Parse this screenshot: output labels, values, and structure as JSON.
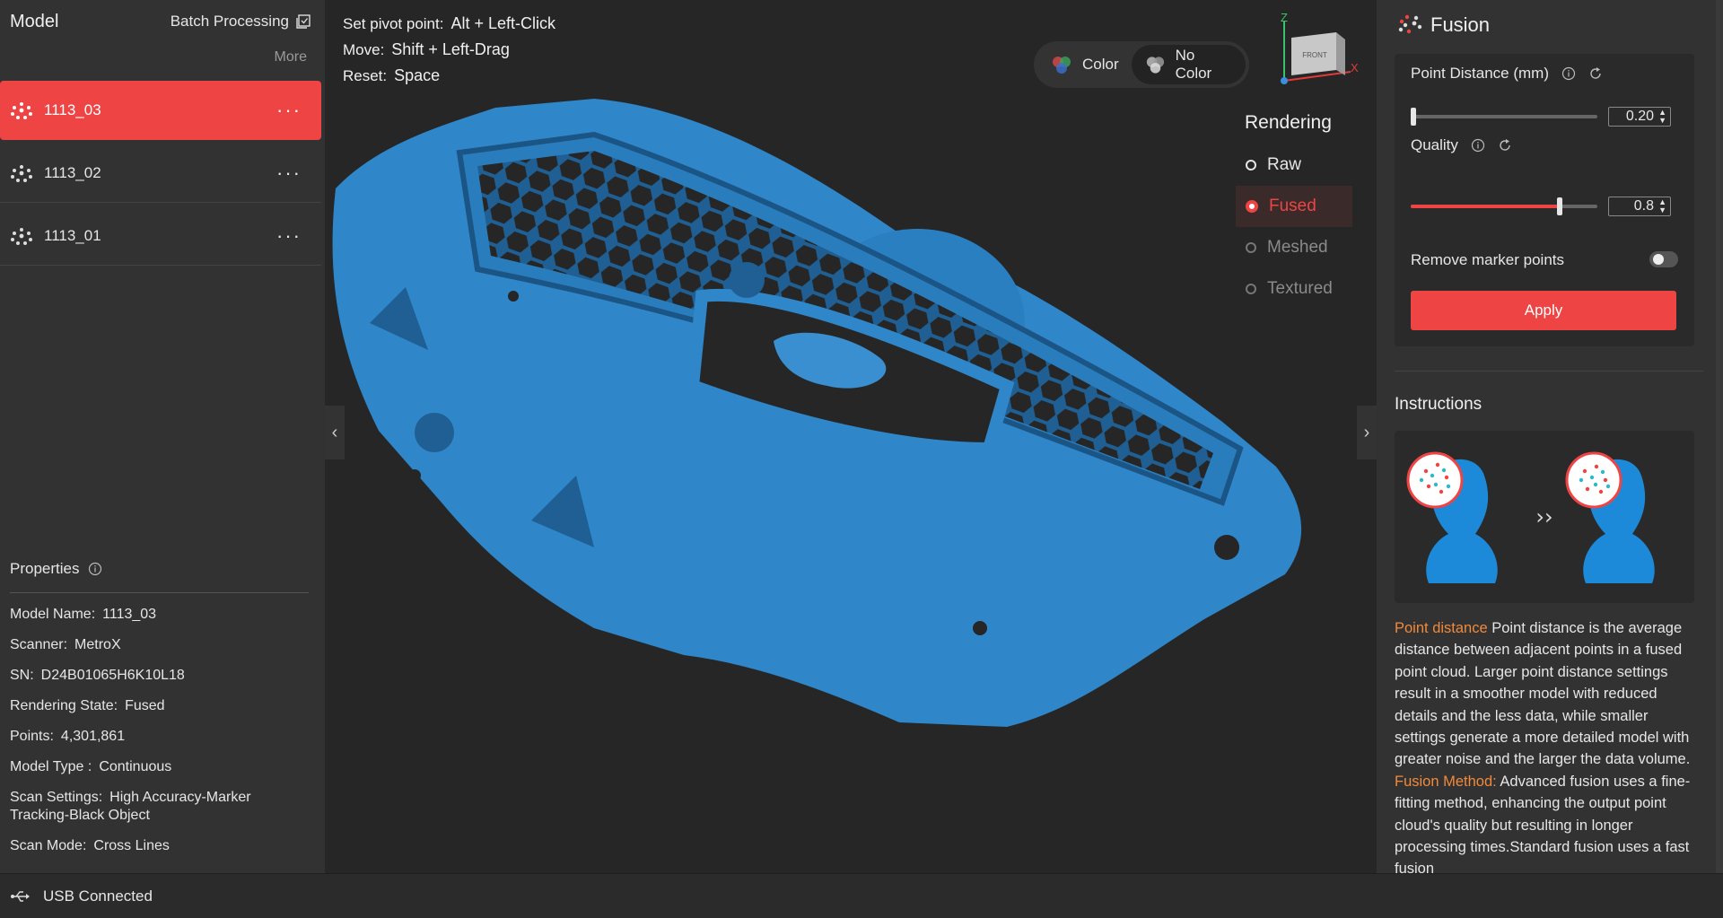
{
  "left_panel": {
    "title": "Model",
    "batch_label": "Batch Processing",
    "more_label": "More",
    "models": [
      {
        "name": "1113_03",
        "active": true
      },
      {
        "name": "1113_02",
        "active": false
      },
      {
        "name": "1113_01",
        "active": false
      }
    ],
    "properties_title": "Properties",
    "properties": [
      {
        "key": "Model Name:",
        "value": "1113_03"
      },
      {
        "key": "Scanner:",
        "value": "MetroX"
      },
      {
        "key": "SN:",
        "value": "D24B01065H6K10L18"
      },
      {
        "key": "Rendering State:",
        "value": "Fused"
      },
      {
        "key": "Points:",
        "value": "4,301,861"
      },
      {
        "key": "Model Type :",
        "value": "Continuous"
      },
      {
        "key": "Scan Settings:",
        "value": "High Accuracy-Marker Tracking-Black Object"
      },
      {
        "key": "Scan Mode:",
        "value": "Cross Lines"
      }
    ]
  },
  "hints": [
    {
      "key": "Set pivot point:",
      "value": "Alt + Left-Click"
    },
    {
      "key": "Move:",
      "value": "Shift + Left-Drag"
    },
    {
      "key": "Reset:",
      "value": "Space"
    }
  ],
  "color_toggle": {
    "color_label": "Color",
    "no_color_label": "No Color",
    "selected": "No Color"
  },
  "axis": {
    "z": "Z",
    "x": "X",
    "face": "FRONT"
  },
  "rendering": {
    "title": "Rendering",
    "options": [
      {
        "label": "Raw",
        "state": "enabled"
      },
      {
        "label": "Fused",
        "state": "selected"
      },
      {
        "label": "Meshed",
        "state": "disabled"
      },
      {
        "label": "Textured",
        "state": "disabled"
      }
    ]
  },
  "fusion": {
    "title": "Fusion",
    "point_distance_label": "Point Distance (mm)",
    "point_distance_value": "0.20",
    "point_distance_fraction": 0.01,
    "quality_label": "Quality",
    "quality_value": "0.8",
    "quality_fraction": 0.8,
    "remove_marker_label": "Remove marker points",
    "remove_marker_on": false,
    "apply_label": "Apply"
  },
  "instructions": {
    "title": "Instructions",
    "point_distance_term": "Point distance",
    "point_distance_text": " Point distance is the average distance between adjacent points in a fused point cloud. Larger point distance settings result in a smoother model with reduced details and the less data, while smaller settings generate a more detailed model with greater noise and the larger the data volume. ",
    "fusion_method_term": "Fusion Method:",
    "fusion_method_text": " Advanced fusion uses a fine-fitting method, enhancing the output point cloud's quality but resulting in longer processing times.Standard fusion uses a fast fusion"
  },
  "status": {
    "usb": "USB Connected"
  },
  "colors": {
    "accent": "#ef4444",
    "scan_blue": "#2f86c8",
    "highlight": "#f08a3c"
  }
}
